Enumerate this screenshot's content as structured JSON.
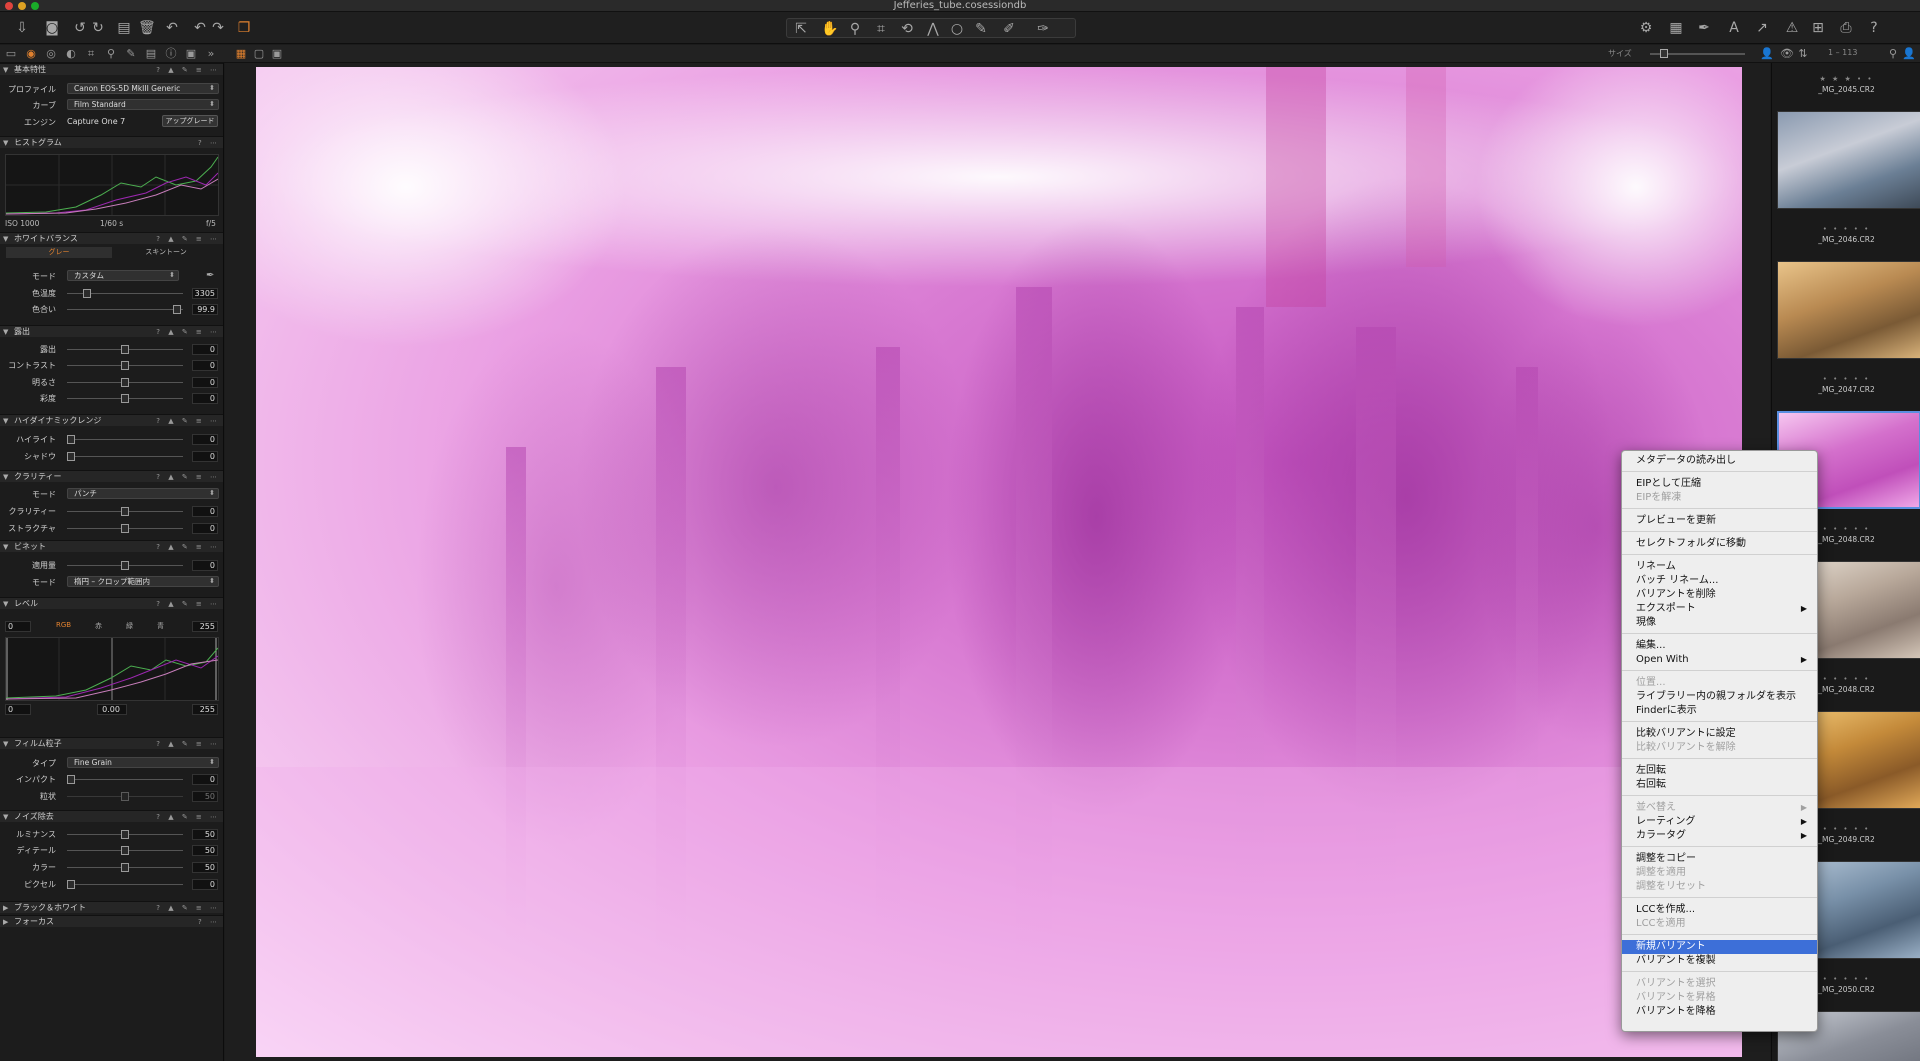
{
  "window": {
    "title": "Jefferies_tube.cosessiondb"
  },
  "toolbar": {
    "size_label": "サイズ",
    "count_label": "1 – 113"
  },
  "left": {
    "basic": {
      "title": "基本特性",
      "profile_label": "プロファイル",
      "profile_value": "Canon EOS-5D MkIII Generic",
      "curve_label": "カーブ",
      "curve_value": "Film Standard",
      "engine_label": "エンジン",
      "engine_value": "Capture One 7",
      "upgrade_label": "アップグレード"
    },
    "histogram": {
      "title": "ヒストグラム",
      "iso": "ISO 1000",
      "shutter": "1/60 s",
      "aperture": "f/5"
    },
    "wb": {
      "title": "ホワイトバランス",
      "tab1": "グレー",
      "tab2": "スキントーン",
      "mode_label": "モード",
      "mode_value": "カスタム",
      "temp_label": "色温度",
      "temp_value": "3305",
      "tint_label": "色合い",
      "tint_value": "99.9"
    },
    "exposure": {
      "title": "露出",
      "rows": [
        {
          "label": "露出",
          "value": "0"
        },
        {
          "label": "コントラスト",
          "value": "0"
        },
        {
          "label": "明るさ",
          "value": "0"
        },
        {
          "label": "彩度",
          "value": "0"
        }
      ]
    },
    "hdr": {
      "title": "ハイダイナミックレンジ",
      "rows": [
        {
          "label": "ハイライト",
          "value": "0"
        },
        {
          "label": "シャドウ",
          "value": "0"
        }
      ]
    },
    "clarity": {
      "title": "クラリティー",
      "mode_label": "モード",
      "mode_value": "パンチ",
      "rows": [
        {
          "label": "クラリティー",
          "value": "0"
        },
        {
          "label": "ストラクチャ",
          "value": "0"
        }
      ]
    },
    "vignette": {
      "title": "ビネット",
      "amount_label": "適用量",
      "amount_value": "0",
      "mode_label": "モード",
      "mode_value": "楕円 – クロップ範囲内"
    },
    "levels": {
      "title": "レベル",
      "low": "0",
      "high": "255",
      "tabs": [
        "RGB",
        "赤",
        "緑",
        "青"
      ],
      "out_low": "0",
      "mid": "0.00",
      "out_high": "255"
    },
    "grain": {
      "title": "フィルム粒子",
      "type_label": "タイプ",
      "type_value": "Fine Grain",
      "impact_label": "インパクト",
      "impact_value": "0",
      "gran_label": "粒状",
      "gran_value": "50"
    },
    "noise": {
      "title": "ノイズ除去",
      "rows": [
        {
          "label": "ルミナンス",
          "value": "50"
        },
        {
          "label": "ディテール",
          "value": "50"
        },
        {
          "label": "カラー",
          "value": "50"
        },
        {
          "label": "ピクセル",
          "value": "0"
        }
      ]
    },
    "bw": {
      "title": "ブラック＆ホワイト"
    },
    "focus": {
      "title": "フォーカス"
    }
  },
  "thumbs": [
    {
      "stars": "★ ★ ★ • •",
      "name": "_MG_2045.CR2"
    },
    {
      "stars": "• • • • •",
      "name": "_MG_2046.CR2"
    },
    {
      "stars": "• • • • •",
      "name": "_MG_2047.CR2"
    },
    {
      "stars": "• • • • •",
      "name": "_MG_2048.CR2"
    },
    {
      "stars": "• • • • •",
      "name": "_MG_2048.CR2"
    },
    {
      "stars": "• • • • •",
      "name": "_MG_2049.CR2"
    },
    {
      "stars": "• • • • •",
      "name": "_MG_2050.CR2"
    }
  ],
  "menu": {
    "items": [
      {
        "label": "メタデータの読み出し",
        "disabled": false
      },
      {
        "label": "EIPとして圧縮",
        "disabled": false
      },
      {
        "label": "EIPを解凍",
        "disabled": true
      },
      {
        "label": "プレビューを更新",
        "disabled": false
      },
      {
        "label": "セレクトフォルダに移動",
        "disabled": false
      },
      {
        "label": "リネーム",
        "disabled": false
      },
      {
        "label": "バッチ リネーム...",
        "disabled": false
      },
      {
        "label": "バリアントを削除",
        "disabled": false
      },
      {
        "label": "エクスポート",
        "disabled": false
      },
      {
        "label": "現像",
        "disabled": false
      },
      {
        "label": "編集...",
        "disabled": false
      },
      {
        "label": "Open With",
        "disabled": false
      },
      {
        "label": "位置...",
        "disabled": true
      },
      {
        "label": "ライブラリー内の親フォルダを表示",
        "disabled": false
      },
      {
        "label": "Finderに表示",
        "disabled": false
      },
      {
        "label": "比較バリアントに設定",
        "disabled": false
      },
      {
        "label": "比較バリアントを解除",
        "disabled": true
      },
      {
        "label": "左回転",
        "disabled": false
      },
      {
        "label": "右回転",
        "disabled": false
      },
      {
        "label": "並べ替え",
        "disabled": true
      },
      {
        "label": "レーティング",
        "disabled": false
      },
      {
        "label": "カラータグ",
        "disabled": false
      },
      {
        "label": "調整をコピー",
        "disabled": false
      },
      {
        "label": "調整を適用",
        "disabled": true
      },
      {
        "label": "調整をリセット",
        "disabled": true
      },
      {
        "label": "LCCを作成...",
        "disabled": false
      },
      {
        "label": "LCCを適用",
        "disabled": true
      },
      {
        "label": "新規バリアント",
        "disabled": false
      },
      {
        "label": "バリアントを複製",
        "disabled": false
      },
      {
        "label": "バリアントを選択",
        "disabled": true
      },
      {
        "label": "バリアントを昇格",
        "disabled": true
      },
      {
        "label": "バリアントを降格",
        "disabled": false
      }
    ]
  },
  "colors": {
    "accent": "#3d6fd8",
    "photo_magenta": "#d87ad2",
    "histo_green": "#4caf50",
    "histo_purple": "#9c27b0"
  }
}
